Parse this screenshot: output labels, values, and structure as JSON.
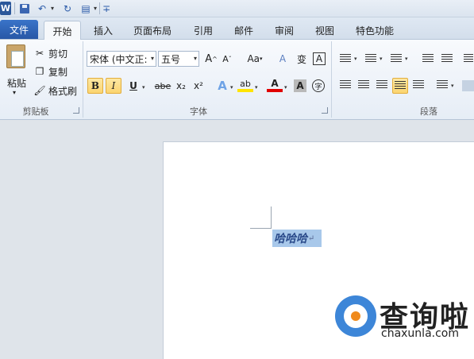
{
  "qat": {
    "logo": "W",
    "dd": "▾",
    "custom": "∓"
  },
  "tabs": [
    "文件",
    "开始",
    "插入",
    "页面布局",
    "引用",
    "邮件",
    "审阅",
    "视图",
    "特色功能"
  ],
  "clipboard": {
    "paste_label": "粘贴",
    "cut_label": "剪切",
    "copy_label": "复制",
    "format_painter_label": "格式刷",
    "group_label": "剪贴板"
  },
  "font": {
    "font_name": "宋体 (中文正:",
    "font_size": "五号",
    "grow": "A",
    "shrink": "A",
    "change_case": "Aa",
    "clear_format": "A",
    "phonetic": "变",
    "border_char": "A",
    "bold": "B",
    "italic": "I",
    "underline": "U",
    "strike": "abe",
    "subscript": "x₂",
    "superscript": "x²",
    "text_effects": "A",
    "highlight": "ab",
    "font_color": "A",
    "char_shading": "A",
    "enclose": "字",
    "group_label": "字体"
  },
  "paragraph": {
    "group_label": "段落"
  },
  "document": {
    "selected_text": "哈哈哈",
    "para_mark": "↵"
  },
  "watermark": {
    "brand": "查询啦",
    "url": "chaxunla.com"
  },
  "colors": {
    "file_tab": "#2b5aa8",
    "highlight_yellow": "#ffe400",
    "font_red": "#e00000",
    "selection": "#a8c8ea"
  }
}
